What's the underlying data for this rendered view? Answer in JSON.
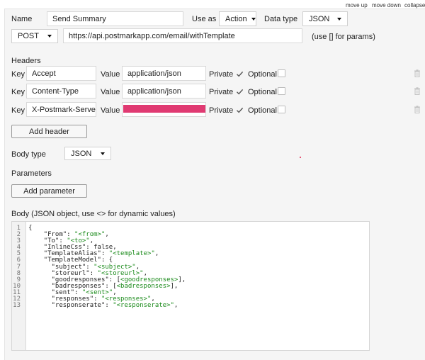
{
  "top_controls": {
    "move_up": "move up",
    "move_down": "move down",
    "collapse": "collapse"
  },
  "call": {
    "name_label": "Name",
    "name_value": "Send Summary",
    "use_as_label": "Use as",
    "use_as_value": "Action",
    "data_type_label": "Data type",
    "data_type_value": "JSON",
    "method_value": "POST",
    "url_value": "https://api.postmarkapp.com/email/withTemplate",
    "params_hint": "(use [] for params)"
  },
  "headers": {
    "title": "Headers",
    "key_label": "Key",
    "value_label": "Value",
    "private_label": "Private",
    "optional_label": "Optional",
    "rows": [
      {
        "key": "Accept",
        "value": "application/json",
        "private": true,
        "optional": false,
        "masked": false
      },
      {
        "key": "Content-Type",
        "value": "application/json",
        "private": true,
        "optional": false,
        "masked": false
      },
      {
        "key": "X-Postmark-Server-To",
        "value": "",
        "private": true,
        "optional": false,
        "masked": true
      }
    ],
    "add_button": "Add header"
  },
  "body_type": {
    "label": "Body type",
    "value": "JSON"
  },
  "parameters": {
    "title": "Parameters",
    "add_button": "Add parameter"
  },
  "body": {
    "label": "Body (JSON object, use <> for dynamic values)",
    "line_numbers": [
      "1",
      "2",
      "3",
      "4",
      "5",
      "6",
      "7",
      "8",
      "9",
      "10",
      "11",
      "12",
      "13"
    ],
    "lines": [
      [
        {
          "t": "{",
          "c": "key"
        }
      ],
      [
        {
          "t": "    \"From\": ",
          "c": "key"
        },
        {
          "t": "\"<from>\"",
          "c": "str"
        },
        {
          "t": ",",
          "c": "key"
        }
      ],
      [
        {
          "t": "    \"To\": ",
          "c": "key"
        },
        {
          "t": "\"<to>\"",
          "c": "str"
        },
        {
          "t": ",",
          "c": "key"
        }
      ],
      [
        {
          "t": "    \"InlineCss\": false,",
          "c": "key"
        }
      ],
      [
        {
          "t": "    \"TemplateAlias\": ",
          "c": "key"
        },
        {
          "t": "\"<template>\"",
          "c": "str"
        },
        {
          "t": ",",
          "c": "key"
        }
      ],
      [
        {
          "t": "    \"TemplateModel\": {",
          "c": "key"
        }
      ],
      [
        {
          "t": "      \"subject\": ",
          "c": "key"
        },
        {
          "t": "\"<subject>\"",
          "c": "str"
        },
        {
          "t": ",",
          "c": "key"
        }
      ],
      [
        {
          "t": "      \"storeurl\": ",
          "c": "key"
        },
        {
          "t": "\"<storeurl>\"",
          "c": "str"
        },
        {
          "t": ",",
          "c": "key"
        }
      ],
      [
        {
          "t": "      \"goodresponses\": [",
          "c": "key"
        },
        {
          "t": "<goodresponses>",
          "c": "str"
        },
        {
          "t": "],",
          "c": "key"
        }
      ],
      [
        {
          "t": "      \"badresponses\": [",
          "c": "key"
        },
        {
          "t": "<badresponses>",
          "c": "str"
        },
        {
          "t": "],",
          "c": "key"
        }
      ],
      [
        {
          "t": "      \"sent\": ",
          "c": "key"
        },
        {
          "t": "\"<sent>\"",
          "c": "str"
        },
        {
          "t": ",",
          "c": "key"
        }
      ],
      [
        {
          "t": "      \"responses\": ",
          "c": "key"
        },
        {
          "t": "\"<responses>\"",
          "c": "str"
        },
        {
          "t": ",",
          "c": "key"
        }
      ],
      [
        {
          "t": "      \"responserate\": ",
          "c": "key"
        },
        {
          "t": "\"<responserate>\"",
          "c": "str"
        },
        {
          "t": ",",
          "c": "key"
        }
      ]
    ]
  },
  "colors": {
    "masked_value": "#e03a72",
    "string": "#1a8a1a",
    "check": "#555555"
  },
  "icons": {
    "trash": "trash-icon",
    "check": "check-icon",
    "caret": "chevron-down-icon"
  }
}
